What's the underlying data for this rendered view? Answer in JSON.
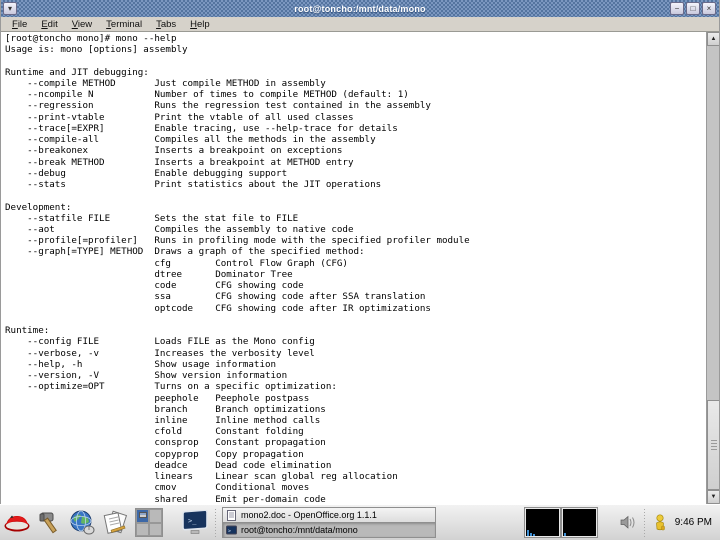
{
  "window": {
    "title": "root@toncho:/mnt/data/mono",
    "menu": [
      "File",
      "Edit",
      "View",
      "Terminal",
      "Tabs",
      "Help"
    ],
    "controls": {
      "menu_glyph": "▾",
      "minimize": "−",
      "maximize": "□",
      "close": "×"
    },
    "scrollbar": {
      "up_glyph": "▲",
      "down_glyph": "▼"
    }
  },
  "terminal": {
    "text_lines": [
      "[root@toncho mono]# mono --help",
      "Usage is: mono [options] assembly",
      "",
      "Runtime and JIT debugging:",
      "    --compile METHOD       Just compile METHOD in assembly",
      "    --ncompile N           Number of times to compile METHOD (default: 1)",
      "    --regression           Runs the regression test contained in the assembly",
      "    --print-vtable         Print the vtable of all used classes",
      "    --trace[=EXPR]         Enable tracing, use --help-trace for details",
      "    --compile-all          Compiles all the methods in the assembly",
      "    --breakonex            Inserts a breakpoint on exceptions",
      "    --break METHOD         Inserts a breakpoint at METHOD entry",
      "    --debug                Enable debugging support",
      "    --stats                Print statistics about the JIT operations",
      "",
      "Development:",
      "    --statfile FILE        Sets the stat file to FILE",
      "    --aot                  Compiles the assembly to native code",
      "    --profile[=profiler]   Runs in profiling mode with the specified profiler module",
      "    --graph[=TYPE] METHOD  Draws a graph of the specified method:",
      "                           cfg        Control Flow Graph (CFG)",
      "                           dtree      Dominator Tree",
      "                           code       CFG showing code",
      "                           ssa        CFG showing code after SSA translation",
      "                           optcode    CFG showing code after IR optimizations",
      "",
      "Runtime:",
      "    --config FILE          Loads FILE as the Mono config",
      "    --verbose, -v          Increases the verbosity level",
      "    --help, -h             Show usage information",
      "    --version, -V          Show version information",
      "    --optimize=OPT         Turns on a specific optimization:",
      "                           peephole   Peephole postpass",
      "                           branch     Branch optimizations",
      "                           inline     Inline method calls",
      "                           cfold      Constant folding",
      "                           consprop   Constant propagation",
      "                           copyprop   Copy propagation",
      "                           deadce     Dead code elimination",
      "                           linears    Linear scan global reg allocation",
      "                           cmov       Conditional moves",
      "                           shared     Emit per-domain code"
    ]
  },
  "taskbar": {
    "window_list": [
      {
        "title": "mono2.doc - OpenOffice.org 1.1.1",
        "icon": "document",
        "active": false
      },
      {
        "title": "root@toncho:/mnt/data/mono",
        "icon": "terminal",
        "active": true
      }
    ],
    "clock": "9:46 PM"
  },
  "colors": {
    "titlebar_blue": "#54749f",
    "titlebar_blue_light": "#7b97c0",
    "pager_active_blue": "#3d68a7",
    "panel_gray": "#d8d8d8",
    "monitor_bar_blue": "#3d8fd4",
    "redhat_red": "#cc0000",
    "alert_yellow": "#e8c12f"
  }
}
